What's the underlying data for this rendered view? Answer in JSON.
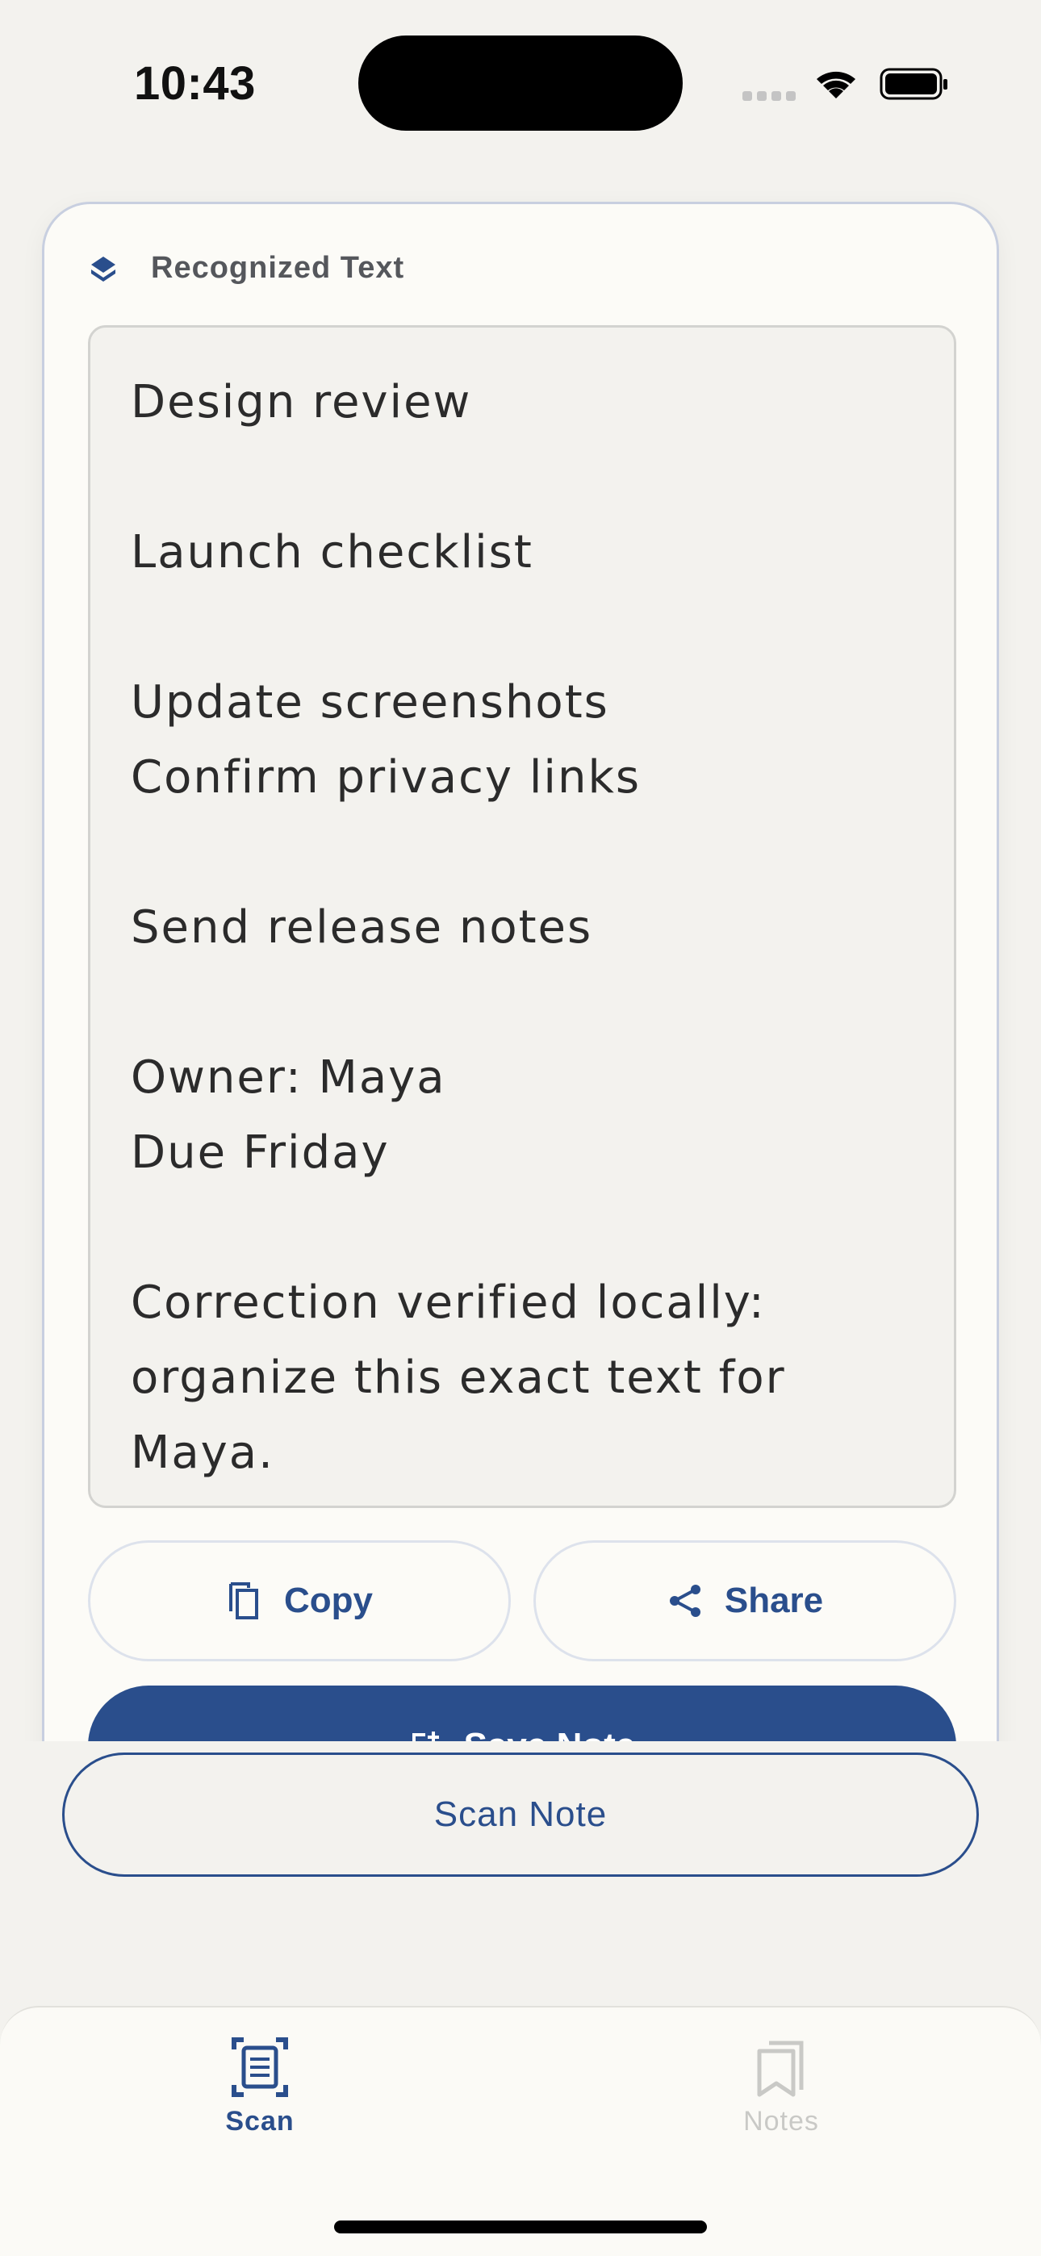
{
  "status_bar": {
    "time": "10:43"
  },
  "card": {
    "header_label": "Recognized Text",
    "recognized_lines": [
      "Design review",
      "",
      "Launch checklist",
      "",
      "Update screenshots",
      "Confirm privacy links",
      "",
      "Send release notes",
      "",
      "Owner: Maya",
      "Due Friday",
      "",
      "Correction verified locally:",
      "organize this exact text for",
      "Maya."
    ],
    "copy_label": "Copy",
    "share_label": "Share",
    "save_label": "Save Note"
  },
  "scan_button_label": "Scan Note",
  "tabs": [
    {
      "label": "Scan",
      "icon": "scan-document-icon",
      "active": true
    },
    {
      "label": "Notes",
      "icon": "notes-bookmark-icon",
      "active": false
    }
  ],
  "colors": {
    "accent": "#2a4e8c",
    "background": "#f3f2ee",
    "card": "#fcfbf7"
  }
}
